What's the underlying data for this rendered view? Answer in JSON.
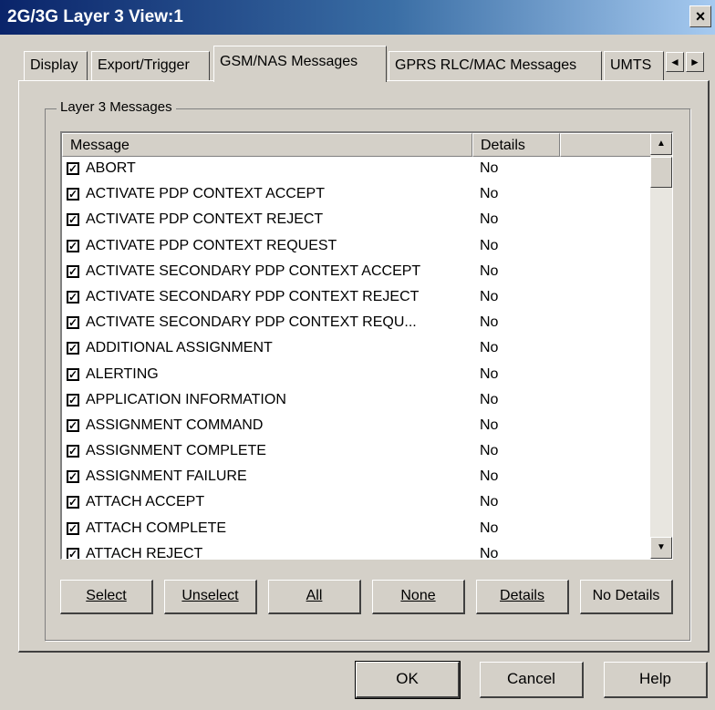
{
  "window": {
    "title": "2G/3G Layer 3 View:1",
    "close_glyph": "×"
  },
  "tabs": [
    {
      "label": "Display"
    },
    {
      "label": "Export/Trigger"
    },
    {
      "label": "GSM/NAS Messages"
    },
    {
      "label": "GPRS RLC/MAC Messages"
    },
    {
      "label": "UMTS"
    }
  ],
  "tab_scroll": {
    "left": "◄",
    "right": "►"
  },
  "group": {
    "label": "Layer 3 Messages"
  },
  "list": {
    "columns": [
      "Message",
      "Details"
    ],
    "rows": [
      {
        "message": "ABORT",
        "details": "No"
      },
      {
        "message": "ACTIVATE PDP CONTEXT ACCEPT",
        "details": "No"
      },
      {
        "message": "ACTIVATE PDP CONTEXT REJECT",
        "details": "No"
      },
      {
        "message": "ACTIVATE PDP CONTEXT REQUEST",
        "details": "No"
      },
      {
        "message": "ACTIVATE SECONDARY PDP CONTEXT ACCEPT",
        "details": "No"
      },
      {
        "message": "ACTIVATE SECONDARY PDP CONTEXT REJECT",
        "details": "No"
      },
      {
        "message": "ACTIVATE SECONDARY PDP CONTEXT REQU...",
        "details": "No"
      },
      {
        "message": "ADDITIONAL ASSIGNMENT",
        "details": "No"
      },
      {
        "message": "ALERTING",
        "details": "No"
      },
      {
        "message": "APPLICATION INFORMATION",
        "details": "No"
      },
      {
        "message": "ASSIGNMENT COMMAND",
        "details": "No"
      },
      {
        "message": "ASSIGNMENT COMPLETE",
        "details": "No"
      },
      {
        "message": "ASSIGNMENT FAILURE",
        "details": "No"
      },
      {
        "message": "ATTACH ACCEPT",
        "details": "No"
      },
      {
        "message": "ATTACH COMPLETE",
        "details": "No"
      },
      {
        "message": "ATTACH REJECT",
        "details": "No"
      }
    ],
    "checkmark": "✓"
  },
  "scroll": {
    "up": "▲",
    "down": "▼"
  },
  "buttons": {
    "select": "Select",
    "unselect": "Unselect",
    "all": "All",
    "none": "None",
    "details": "Details",
    "no_details": "No Details"
  },
  "dialog": {
    "ok": "OK",
    "cancel": "Cancel",
    "help": "Help"
  }
}
